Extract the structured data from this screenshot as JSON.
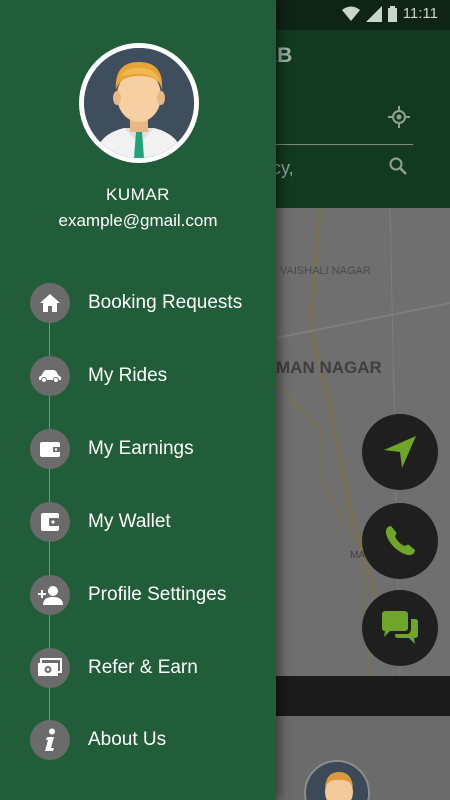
{
  "status_bar": {
    "time": "11:11"
  },
  "background_app": {
    "title_partial": "AB",
    "search_partial": "ncy,",
    "map_labels": [
      "VAISHALI NAGAR",
      "MAN NAGAR",
      "MA"
    ]
  },
  "drawer": {
    "profile": {
      "name": "KUMAR",
      "email": "example@gmail.com"
    },
    "menu": [
      {
        "label": "Booking Requests",
        "icon": "home-icon"
      },
      {
        "label": "My Rides",
        "icon": "car-icon"
      },
      {
        "label": "My Earnings",
        "icon": "wallet-icon"
      },
      {
        "label": "My Wallet",
        "icon": "wallet-card-icon"
      },
      {
        "label": "Profile Settinges",
        "icon": "add-user-icon"
      },
      {
        "label": "Refer & Earn",
        "icon": "money-icon"
      },
      {
        "label": "About Us",
        "icon": "info-icon"
      }
    ]
  },
  "colors": {
    "drawer_bg": "#225d39",
    "menu_icon_bg": "#6b6b6b",
    "fab_icon": "#6fa52a"
  }
}
